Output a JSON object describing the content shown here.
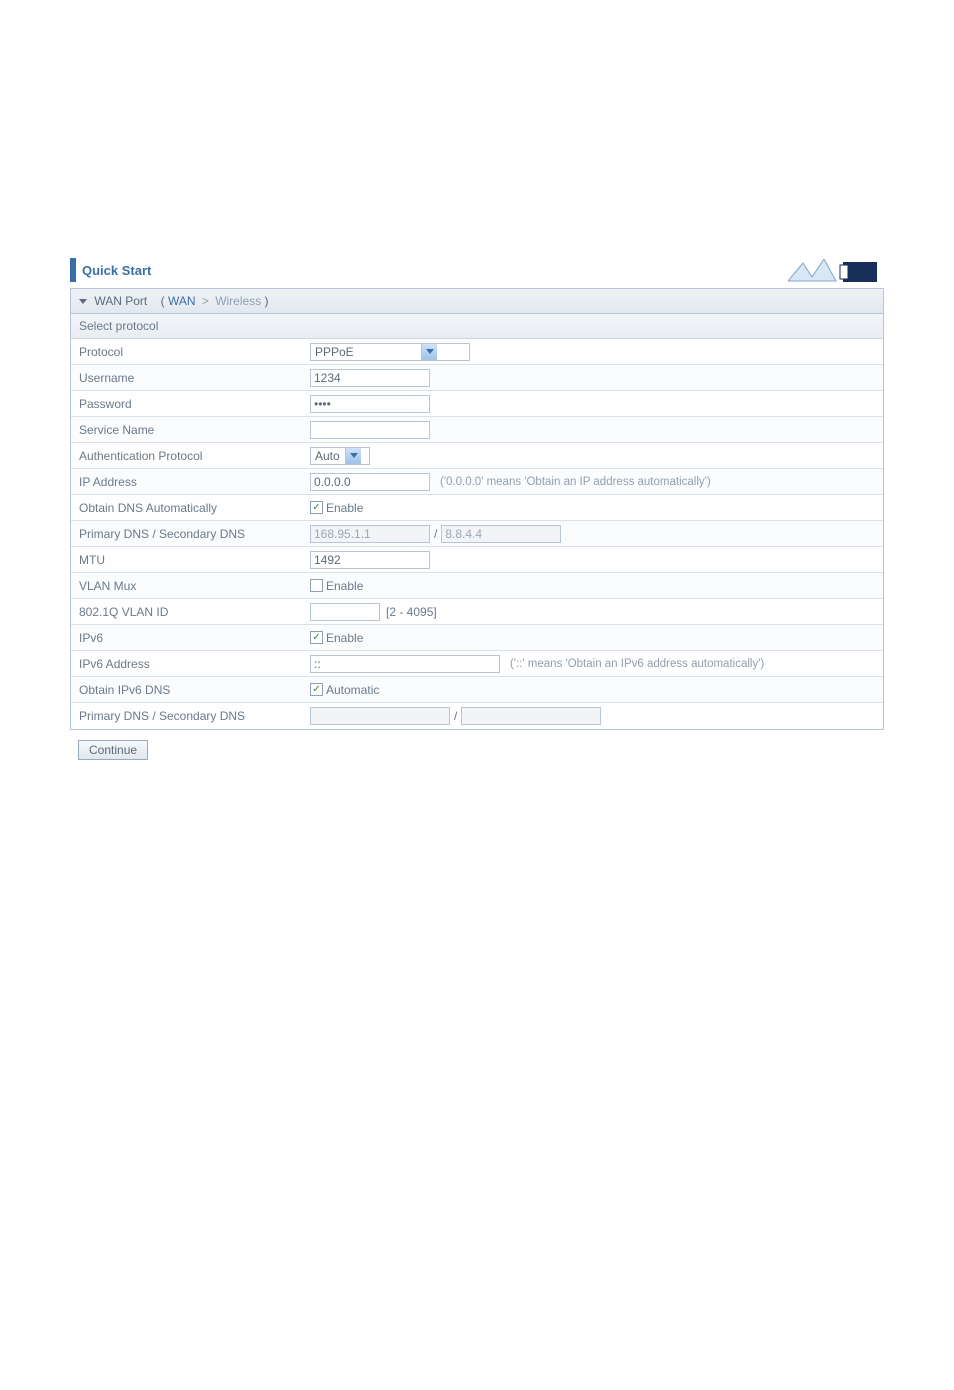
{
  "title": "Quick Start",
  "breadcrumb": {
    "prefix": "WAN Port",
    "open": "(",
    "wan": "WAN",
    "sep": " > ",
    "wireless": "Wireless",
    "close": ")"
  },
  "subheader": "Select protocol",
  "rows": {
    "protocol": {
      "label": "Protocol",
      "value": "PPPoE"
    },
    "username": {
      "label": "Username",
      "value": "1234"
    },
    "password": {
      "label": "Password",
      "value": "••••"
    },
    "service_name": {
      "label": "Service Name",
      "value": ""
    },
    "auth_protocol": {
      "label": "Authentication Protocol",
      "value": "Auto"
    },
    "ip_address": {
      "label": "IP Address",
      "value": "0.0.0.0",
      "hint": "('0.0.0.0' means 'Obtain an IP address automatically')"
    },
    "obtain_dns": {
      "label": "Obtain DNS Automatically",
      "checkbox_label": "Enable",
      "checked": true
    },
    "dns": {
      "label": "Primary DNS / Secondary DNS",
      "primary": "168.95.1.1",
      "sep": "/",
      "secondary": "8.8.4.4"
    },
    "mtu": {
      "label": "MTU",
      "value": "1492"
    },
    "vlan_mux": {
      "label": "VLAN Mux",
      "checkbox_label": "Enable",
      "checked": false
    },
    "vlan_id": {
      "label": "802.1Q VLAN ID",
      "value": "",
      "range": "[2 - 4095]"
    },
    "ipv6": {
      "label": "IPv6",
      "checkbox_label": "Enable",
      "checked": true
    },
    "ipv6_addr": {
      "label": "IPv6 Address",
      "value": "::",
      "hint": "('::' means 'Obtain an IPv6 address automatically')"
    },
    "obtain_ipv6_dns": {
      "label": "Obtain IPv6 DNS",
      "checkbox_label": "Automatic",
      "checked": true
    },
    "ipv6_dns": {
      "label": "Primary DNS / Secondary DNS",
      "primary": "",
      "sep": "/",
      "secondary": ""
    }
  },
  "button": {
    "continue": "Continue"
  }
}
